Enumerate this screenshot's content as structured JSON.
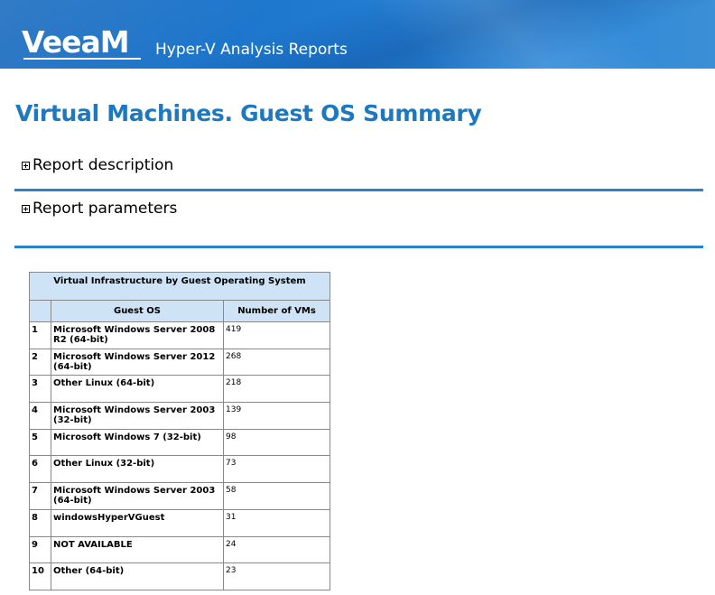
{
  "header": {
    "logo_text": "VeeaM",
    "app_title": "Hyper-V Analysis Reports"
  },
  "page_title": "Virtual Machines. Guest OS Summary",
  "sections": {
    "description_label": "Report description",
    "parameters_label": "Report parameters"
  },
  "table": {
    "caption": "Virtual Infrastructure by Guest Operating System",
    "columns": [
      "",
      "Guest OS",
      "Number of VMs"
    ],
    "rows": [
      {
        "num": "1",
        "os": "Microsoft Windows Server 2008 R2 (64-bit)",
        "vms": "419"
      },
      {
        "num": "2",
        "os": "Microsoft Windows Server 2012 (64-bit)",
        "vms": "268"
      },
      {
        "num": "3",
        "os": "Other Linux (64-bit)",
        "vms": "218"
      },
      {
        "num": "4",
        "os": "Microsoft Windows Server 2003 (32-bit)",
        "vms": "139"
      },
      {
        "num": "5",
        "os": "Microsoft Windows 7 (32-bit)",
        "vms": "98"
      },
      {
        "num": "6",
        "os": "Other Linux (32-bit)",
        "vms": "73"
      },
      {
        "num": "7",
        "os": "Microsoft Windows Server 2003 (64-bit)",
        "vms": "58"
      },
      {
        "num": "8",
        "os": "windowsHyperVGuest",
        "vms": "31"
      },
      {
        "num": "9",
        "os": "NOT AVAILABLE",
        "vms": "24"
      },
      {
        "num": "10",
        "os": "Other (64-bit)",
        "vms": "23"
      }
    ]
  },
  "colors": {
    "accent": "#1c78c0",
    "divider": "#2a82c8",
    "table_header_bg": "#cfe3f6"
  }
}
